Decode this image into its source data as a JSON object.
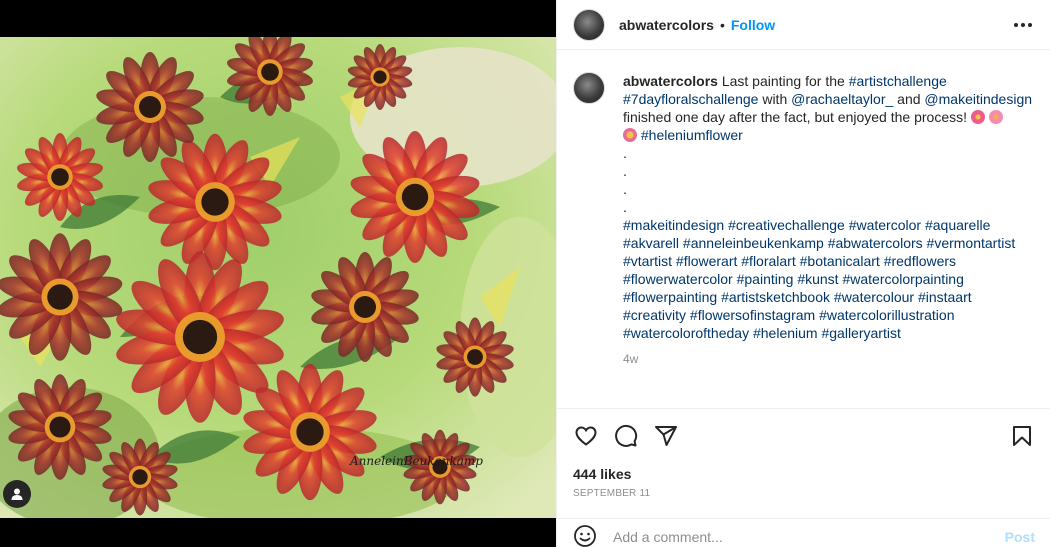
{
  "post": {
    "username": "abwatercolors",
    "follow_label": "Follow",
    "separator": "•"
  },
  "media": {
    "signature": "AnneleinBeukenkamp"
  },
  "caption": {
    "username": "abwatercolors",
    "line1_text": "Last painting for the",
    "line1_tag": "#artistchallenge",
    "line2_tag": "#7dayfloralschallenge",
    "line2_with": "with",
    "line2_mention1": "@rachaeltaylor_",
    "line2_and": "and",
    "line2_mention2": "@makeitindesign",
    "line3_text": "finished one day after the fact, but enjoyed the process!",
    "line4_tag": "#heleniumflower",
    "dots": [
      ".",
      ".",
      ".",
      "."
    ],
    "hashtag_lines": [
      [
        "#makeitindesign",
        "#creativechallenge",
        "#watercolor",
        "#aquarelle"
      ],
      [
        "#akvarell",
        "#anneleinbeukenkamp",
        "#abwatercolors",
        "#vermontartist"
      ],
      [
        "#vtartist",
        "#flowerart",
        "#floralart",
        "#botanicalart",
        "#redflowers"
      ],
      [
        "#flowerwatercolor",
        "#painting",
        "#kunst",
        "#watercolorpainting"
      ],
      [
        "#flowerpainting",
        "#artistsketchbook",
        "#watercolour",
        "#instaart"
      ],
      [
        "#creativity",
        "#flowersofinstagram",
        "#watercolorillustration"
      ],
      [
        "#watercoloroftheday",
        "#helenium",
        "#galleryartist"
      ]
    ],
    "time_ago": "4w"
  },
  "stats": {
    "likes": "444 likes",
    "date": "SEPTEMBER 11"
  },
  "comment": {
    "placeholder": "Add a comment...",
    "post_label": "Post"
  },
  "icons": {
    "like": "heart-icon",
    "comment": "comment-bubble-icon",
    "share": "paper-plane-icon",
    "save": "bookmark-icon",
    "emoji": "smiley-icon",
    "more": "more-options-icon",
    "tagged_user": "user-tag-icon"
  }
}
